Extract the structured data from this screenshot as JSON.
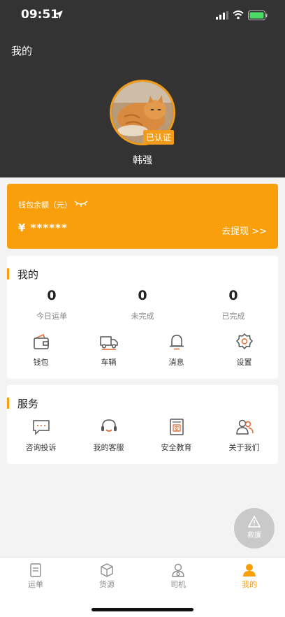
{
  "status_bar": {
    "time": "09:51"
  },
  "header": {
    "title": "我的",
    "verified_badge": "已认证",
    "username": "韩强"
  },
  "wallet": {
    "label": "钱包余额（元）",
    "amount": "¥ ******",
    "withdraw": "去提现 >>"
  },
  "mine": {
    "title": "我的",
    "stats": [
      {
        "value": "0",
        "label": "今日运单"
      },
      {
        "value": "0",
        "label": "未完成"
      },
      {
        "value": "0",
        "label": "已完成"
      }
    ],
    "items": [
      {
        "label": "钱包",
        "icon": "wallet-icon"
      },
      {
        "label": "车辆",
        "icon": "truck-icon"
      },
      {
        "label": "消息",
        "icon": "bell-icon"
      },
      {
        "label": "设置",
        "icon": "settings-icon"
      }
    ]
  },
  "service": {
    "title": "服务",
    "items": [
      {
        "label": "咨询投诉",
        "icon": "chat-icon"
      },
      {
        "label": "我的客服",
        "icon": "headset-icon"
      },
      {
        "label": "安全教育",
        "icon": "safety-book-icon"
      },
      {
        "label": "关于我们",
        "icon": "people-icon"
      }
    ]
  },
  "rescue": {
    "label": "救援"
  },
  "tabs": [
    {
      "label": "运单",
      "icon": "waybill-icon",
      "active": false
    },
    {
      "label": "货源",
      "icon": "cargo-box-icon",
      "active": false
    },
    {
      "label": "司机",
      "icon": "driver-icon",
      "active": false
    },
    {
      "label": "我的",
      "icon": "profile-icon",
      "active": true
    }
  ],
  "colors": {
    "accent": "#f99f0c",
    "header_bg": "#333333",
    "page_bg": "#f3f3f3"
  }
}
